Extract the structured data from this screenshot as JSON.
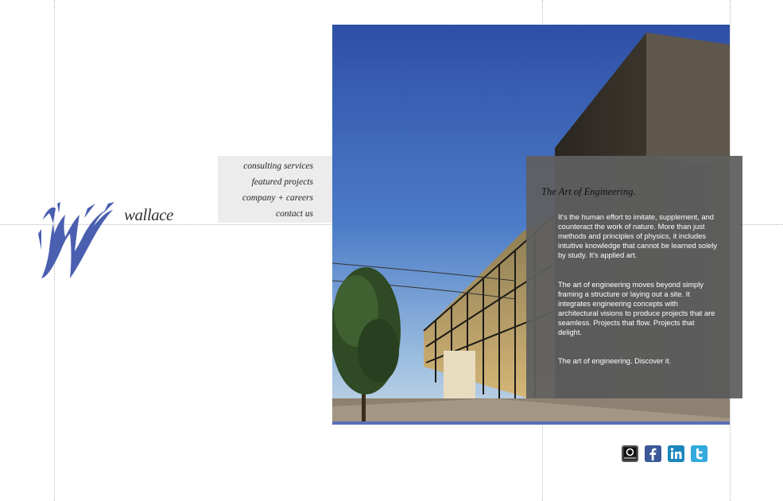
{
  "brand": {
    "name": "wallace",
    "accent": "#4a5fb0"
  },
  "nav": {
    "items": [
      {
        "label": "consulting services"
      },
      {
        "label": "featured projects"
      },
      {
        "label": "company + careers"
      },
      {
        "label": "contact us"
      }
    ]
  },
  "intro": {
    "title": "The Art of Engineering.",
    "paragraphs": [
      "It's the human effort to imitate, supplement, and counteract the work of nature.  More than just methods and principles of physics, it includes intuitive knowledge that cannot be learned solely by study.  It's applied art.",
      "The art of engineering moves beyond simply framing a structure or laying out a site.  It integrates engineering concepts with architectural visions to produce projects that are seamless. Projects that flow.  Projects that delight.",
      "The art of engineering.  Discover it."
    ]
  },
  "social": {
    "icons": [
      {
        "name": "blog-icon",
        "color": "#3a3a3a"
      },
      {
        "name": "facebook-icon",
        "color": "#3b5998"
      },
      {
        "name": "linkedin-icon",
        "color": "#1b86bc"
      },
      {
        "name": "twitter-icon",
        "color": "#33aadd"
      }
    ]
  }
}
